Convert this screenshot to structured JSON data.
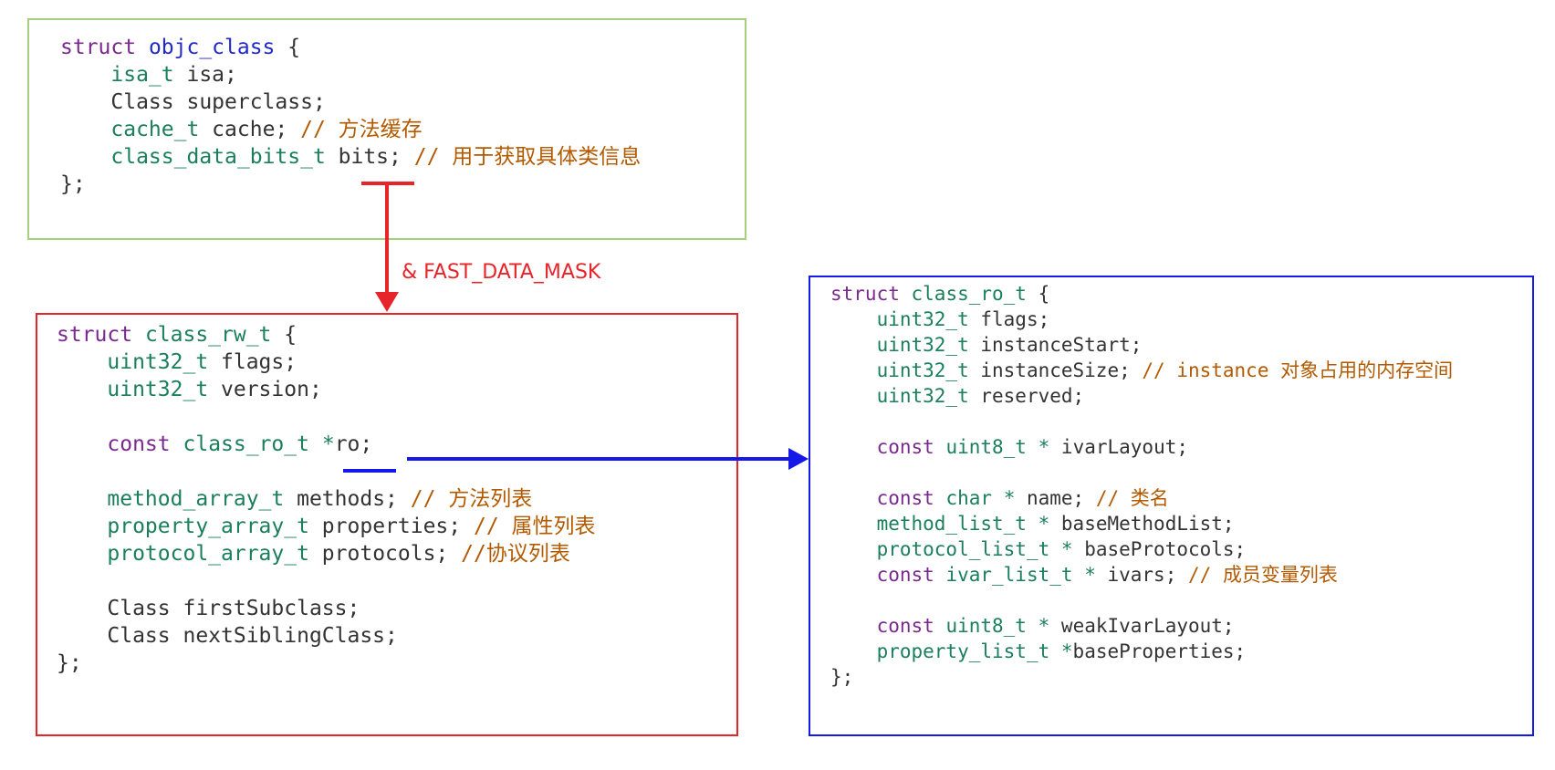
{
  "objc_class": {
    "lines": [
      [
        {
          "t": "struct ",
          "c": "kw"
        },
        {
          "t": "objc_class",
          "c": "nm"
        },
        {
          "t": " {",
          "c": ""
        }
      ],
      [
        {
          "t": "    ",
          "c": ""
        },
        {
          "t": "isa_t",
          "c": "ty"
        },
        {
          "t": " isa;",
          "c": ""
        }
      ],
      [
        {
          "t": "    Class superclass;",
          "c": ""
        }
      ],
      [
        {
          "t": "    ",
          "c": ""
        },
        {
          "t": "cache_t",
          "c": "ty"
        },
        {
          "t": " cache; ",
          "c": ""
        },
        {
          "t": "// ",
          "c": "cm"
        },
        {
          "t": "方法缓存",
          "c": "cm cjk"
        }
      ],
      [
        {
          "t": "    ",
          "c": ""
        },
        {
          "t": "class_data_bits_t",
          "c": "ty"
        },
        {
          "t": " bits; ",
          "c": ""
        },
        {
          "t": "// ",
          "c": "cm"
        },
        {
          "t": "用于获取具体类信息",
          "c": "cm cjk"
        }
      ],
      [
        {
          "t": "};",
          "c": ""
        }
      ]
    ]
  },
  "class_rw_t": {
    "lines": [
      [
        {
          "t": "struct ",
          "c": "kw"
        },
        {
          "t": "class_rw_t",
          "c": "ty"
        },
        {
          "t": " {",
          "c": ""
        }
      ],
      [
        {
          "t": "    ",
          "c": ""
        },
        {
          "t": "uint32_t",
          "c": "ty"
        },
        {
          "t": " flags;",
          "c": ""
        }
      ],
      [
        {
          "t": "    ",
          "c": ""
        },
        {
          "t": "uint32_t",
          "c": "ty"
        },
        {
          "t": " version;",
          "c": ""
        }
      ],
      [],
      [
        {
          "t": "    ",
          "c": ""
        },
        {
          "t": "const",
          "c": "kw"
        },
        {
          "t": " ",
          "c": ""
        },
        {
          "t": "class_ro_t",
          "c": "ty"
        },
        {
          "t": " ",
          "c": ""
        },
        {
          "t": "*",
          "c": "ty"
        },
        {
          "t": "ro;",
          "c": ""
        }
      ],
      [],
      [
        {
          "t": "    ",
          "c": ""
        },
        {
          "t": "method_array_t",
          "c": "ty"
        },
        {
          "t": " methods; ",
          "c": ""
        },
        {
          "t": "// ",
          "c": "cm"
        },
        {
          "t": "方法列表",
          "c": "cm cjk"
        }
      ],
      [
        {
          "t": "    ",
          "c": ""
        },
        {
          "t": "property_array_t",
          "c": "ty"
        },
        {
          "t": " properties; ",
          "c": ""
        },
        {
          "t": "// ",
          "c": "cm"
        },
        {
          "t": "属性列表",
          "c": "cm cjk"
        }
      ],
      [
        {
          "t": "    ",
          "c": ""
        },
        {
          "t": "protocol_array_t",
          "c": "ty"
        },
        {
          "t": " protocols; ",
          "c": ""
        },
        {
          "t": "//",
          "c": "cm"
        },
        {
          "t": "协议列表",
          "c": "cm cjk"
        }
      ],
      [],
      [
        {
          "t": "    Class firstSubclass;",
          "c": ""
        }
      ],
      [
        {
          "t": "    Class nextSiblingClass;",
          "c": ""
        }
      ],
      [
        {
          "t": "};",
          "c": ""
        }
      ]
    ]
  },
  "class_ro_t": {
    "lines": [
      [
        {
          "t": "struct ",
          "c": "kw"
        },
        {
          "t": "class_ro_t",
          "c": "ty"
        },
        {
          "t": " {",
          "c": ""
        }
      ],
      [
        {
          "t": "    ",
          "c": ""
        },
        {
          "t": "uint32_t",
          "c": "ty"
        },
        {
          "t": " flags;",
          "c": ""
        }
      ],
      [
        {
          "t": "    ",
          "c": ""
        },
        {
          "t": "uint32_t",
          "c": "ty"
        },
        {
          "t": " instanceStart;",
          "c": ""
        }
      ],
      [
        {
          "t": "    ",
          "c": ""
        },
        {
          "t": "uint32_t",
          "c": "ty"
        },
        {
          "t": " instanceSize; ",
          "c": ""
        },
        {
          "t": "// instance ",
          "c": "cm"
        },
        {
          "t": "对象占用的内存空间",
          "c": "cm cjk"
        }
      ],
      [
        {
          "t": "    ",
          "c": ""
        },
        {
          "t": "uint32_t",
          "c": "ty"
        },
        {
          "t": " reserved;",
          "c": ""
        }
      ],
      [],
      [
        {
          "t": "    ",
          "c": ""
        },
        {
          "t": "const",
          "c": "kw"
        },
        {
          "t": " ",
          "c": ""
        },
        {
          "t": "uint8_t",
          "c": "ty"
        },
        {
          "t": " ",
          "c": ""
        },
        {
          "t": "*",
          "c": "ty"
        },
        {
          "t": " ivarLayout;",
          "c": ""
        }
      ],
      [],
      [
        {
          "t": "    ",
          "c": ""
        },
        {
          "t": "const",
          "c": "kw"
        },
        {
          "t": " ",
          "c": ""
        },
        {
          "t": "char",
          "c": "ty"
        },
        {
          "t": " ",
          "c": ""
        },
        {
          "t": "*",
          "c": "ty"
        },
        {
          "t": " name; ",
          "c": ""
        },
        {
          "t": "// ",
          "c": "cm"
        },
        {
          "t": "类名",
          "c": "cm cjk"
        }
      ],
      [
        {
          "t": "    ",
          "c": ""
        },
        {
          "t": "method_list_t",
          "c": "ty"
        },
        {
          "t": " ",
          "c": ""
        },
        {
          "t": "*",
          "c": "ty"
        },
        {
          "t": " baseMethodList;",
          "c": ""
        }
      ],
      [
        {
          "t": "    ",
          "c": ""
        },
        {
          "t": "protocol_list_t",
          "c": "ty"
        },
        {
          "t": " ",
          "c": ""
        },
        {
          "t": "*",
          "c": "ty"
        },
        {
          "t": " baseProtocols;",
          "c": ""
        }
      ],
      [
        {
          "t": "    ",
          "c": ""
        },
        {
          "t": "const",
          "c": "kw"
        },
        {
          "t": " ",
          "c": ""
        },
        {
          "t": "ivar_list_t",
          "c": "ty"
        },
        {
          "t": " ",
          "c": ""
        },
        {
          "t": "*",
          "c": "ty"
        },
        {
          "t": " ivars; ",
          "c": ""
        },
        {
          "t": "// ",
          "c": "cm"
        },
        {
          "t": "成员变量列表",
          "c": "cm cjk"
        }
      ],
      [],
      [
        {
          "t": "    ",
          "c": ""
        },
        {
          "t": "const",
          "c": "kw"
        },
        {
          "t": " ",
          "c": ""
        },
        {
          "t": "uint8_t",
          "c": "ty"
        },
        {
          "t": " ",
          "c": ""
        },
        {
          "t": "*",
          "c": "ty"
        },
        {
          "t": " weakIvarLayout;",
          "c": ""
        }
      ],
      [
        {
          "t": "    ",
          "c": ""
        },
        {
          "t": "property_list_t",
          "c": "ty"
        },
        {
          "t": " ",
          "c": ""
        },
        {
          "t": "*",
          "c": "ty"
        },
        {
          "t": "baseProperties;",
          "c": ""
        }
      ],
      [
        {
          "t": "};",
          "c": ""
        }
      ]
    ]
  },
  "arrow_label": "& FAST_DATA_MASK",
  "colors": {
    "objc_box_border": "#a4cf7f",
    "rw_box_border": "#e8242b",
    "ro_box_border": "#1518e6",
    "keyword": "#7a2a8e",
    "type": "#1b7f5b",
    "struct_name": "#2229c9",
    "comment": "#b35a00",
    "text": "#333333"
  }
}
